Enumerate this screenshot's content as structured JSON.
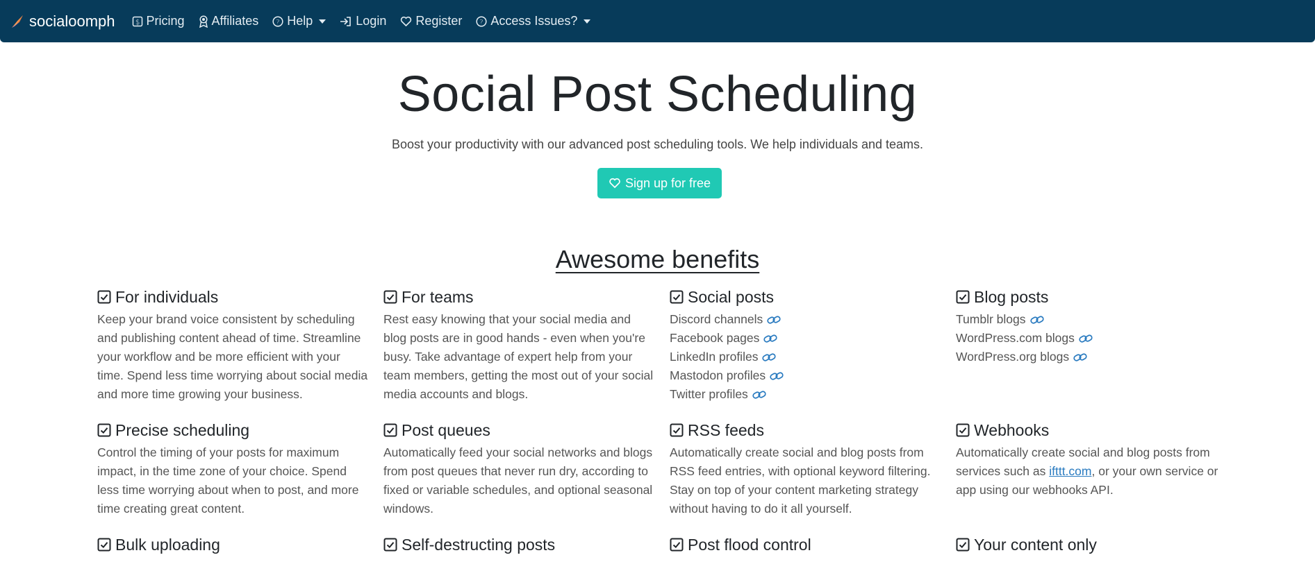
{
  "nav": {
    "brand": "socialoomph",
    "items": [
      {
        "label": "Pricing",
        "icon": "dollar-icon"
      },
      {
        "label": "Affiliates",
        "icon": "award-icon"
      },
      {
        "label": "Help",
        "icon": "question-circle-icon",
        "dropdown": true
      },
      {
        "label": "Login",
        "icon": "login-arrow-icon"
      },
      {
        "label": "Register",
        "icon": "heart-icon"
      },
      {
        "label": "Access Issues?",
        "icon": "question-circle-icon",
        "dropdown": true
      }
    ]
  },
  "hero": {
    "title": "Social Post Scheduling",
    "subtitle": "Boost your productivity with our advanced post scheduling tools. We help individuals and teams.",
    "cta": "Sign up for free"
  },
  "benefits": {
    "title": "Awesome benefits",
    "individuals": {
      "title": "For individuals",
      "text": "Keep your brand voice consistent by scheduling and publishing content ahead of time. Streamline your workflow and be more efficient with your time. Spend less time worrying about social media and more time growing your business."
    },
    "teams": {
      "title": "For teams",
      "text": "Rest easy knowing that your social media and blog posts are in good hands - even when you're busy. Take advantage of expert help from your team members, getting the most out of your social media accounts and blogs."
    },
    "social": {
      "title": "Social posts",
      "items": [
        "Discord channels",
        "Facebook pages",
        "LinkedIn profiles",
        "Mastodon profiles",
        "Twitter profiles"
      ]
    },
    "blog": {
      "title": "Blog posts",
      "items": [
        "Tumblr blogs",
        "WordPress.com blogs",
        "WordPress.org blogs"
      ]
    },
    "precise": {
      "title": "Precise scheduling",
      "text": "Control the timing of your posts for maximum impact, in the time zone of your choice. Spend less time worrying about when to post, and more time creating great content."
    },
    "queues": {
      "title": "Post queues",
      "text": "Automatically feed your social networks and blogs from post queues that never run dry, according to fixed or variable schedules, and optional seasonal windows."
    },
    "rss": {
      "title": "RSS feeds",
      "text": "Automatically create social and blog posts from RSS feed entries, with optional keyword filtering. Stay on top of your content marketing strategy without having to do it all yourself."
    },
    "webhooks": {
      "title": "Webhooks",
      "text_before": "Automatically create social and blog posts from services such as ",
      "link": "ifttt.com",
      "text_after": ", or your own service or app using our webhooks API."
    },
    "bulk": {
      "title": "Bulk uploading"
    },
    "selfdestruct": {
      "title": "Self-destructing posts"
    },
    "flood": {
      "title": "Post flood control"
    },
    "yourcontent": {
      "title": "Your content only"
    }
  },
  "colors": {
    "navbar": "#073b5a",
    "cta": "#20c9b4",
    "link": "#2a7bc0"
  }
}
